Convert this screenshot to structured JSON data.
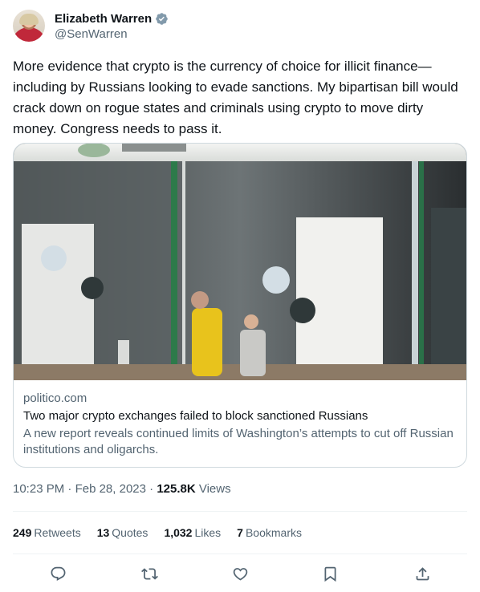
{
  "author": {
    "name": "Elizabeth Warren",
    "handle": "@SenWarren",
    "verified_icon": "verified-badge-icon"
  },
  "tweet": {
    "text": "More evidence that crypto is the currency of choice for illicit finance—including by Russians looking to evade sanctions. My bipartisan bill would crack down on rogue states and criminals using crypto to move dirty money. Congress needs to pass it."
  },
  "card": {
    "domain": "politico.com",
    "title": "Two major crypto exchanges failed to block sanctioned Russians",
    "description": "A new report reveals continued limits of Washington’s attempts to cut off Russian institutions and oligarchs."
  },
  "meta": {
    "time": "10:23 PM",
    "separator": " · ",
    "date": "Feb 28, 2023",
    "views_count": "125.8K",
    "views_label": "Views"
  },
  "stats": {
    "retweets_count": "249",
    "retweets_label": "Retweets",
    "quotes_count": "13",
    "quotes_label": "Quotes",
    "likes_count": "1,032",
    "likes_label": "Likes",
    "bookmarks_count": "7",
    "bookmarks_label": "Bookmarks"
  },
  "actions": [
    "reply-icon",
    "retweet-icon",
    "like-icon",
    "bookmark-icon",
    "share-icon"
  ],
  "colors": {
    "text_primary": "#0f1419",
    "text_secondary": "#536471",
    "border": "#cfd9de",
    "divider": "#eff3f4",
    "verified": "#829aab"
  }
}
